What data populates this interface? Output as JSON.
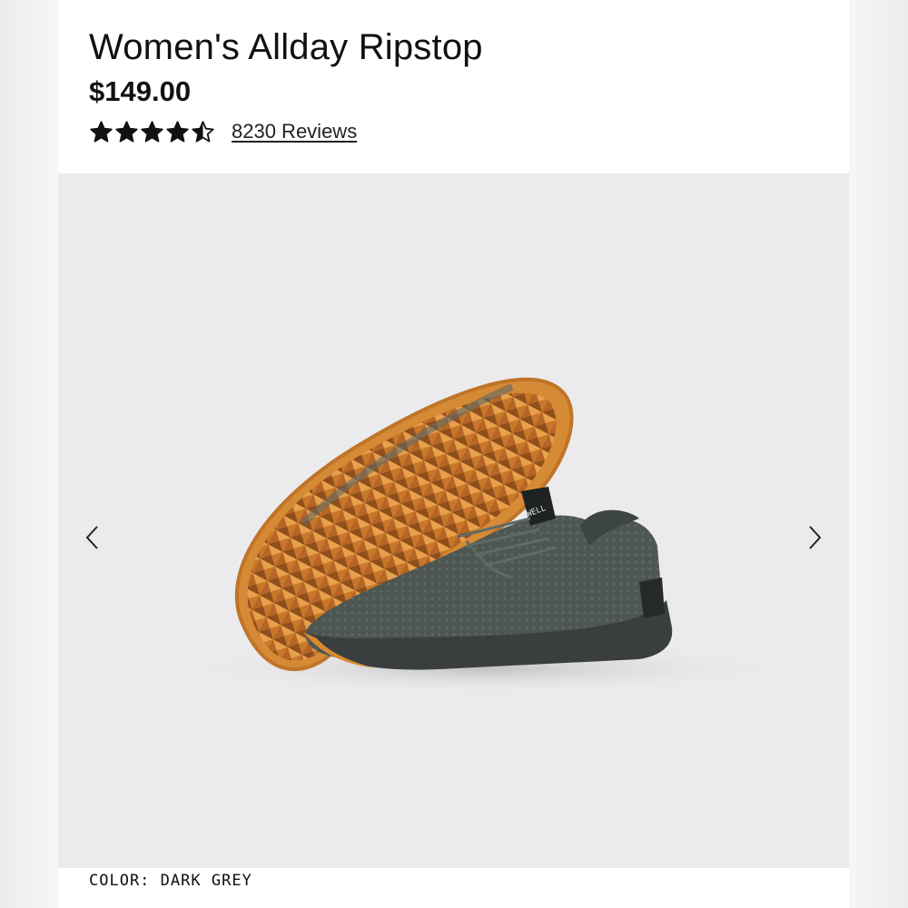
{
  "product": {
    "title": "Women's Allday Ripstop",
    "price": "$149.00",
    "rating": 4.5,
    "rating_max": 5,
    "reviews_label": "8230 Reviews"
  },
  "gallery": {
    "image_icon": "shoe-product-photo",
    "prev_icon": "chevron-left-icon",
    "next_icon": "chevron-right-icon",
    "shoe_brand_mark": "WELL"
  },
  "color": {
    "label": "COLOR:",
    "value": "DARK GREY"
  },
  "colors": {
    "star": "#111111",
    "sole_orange": "#d98a2e",
    "upper_grey": "#4a524d",
    "background": "#ebebed"
  }
}
